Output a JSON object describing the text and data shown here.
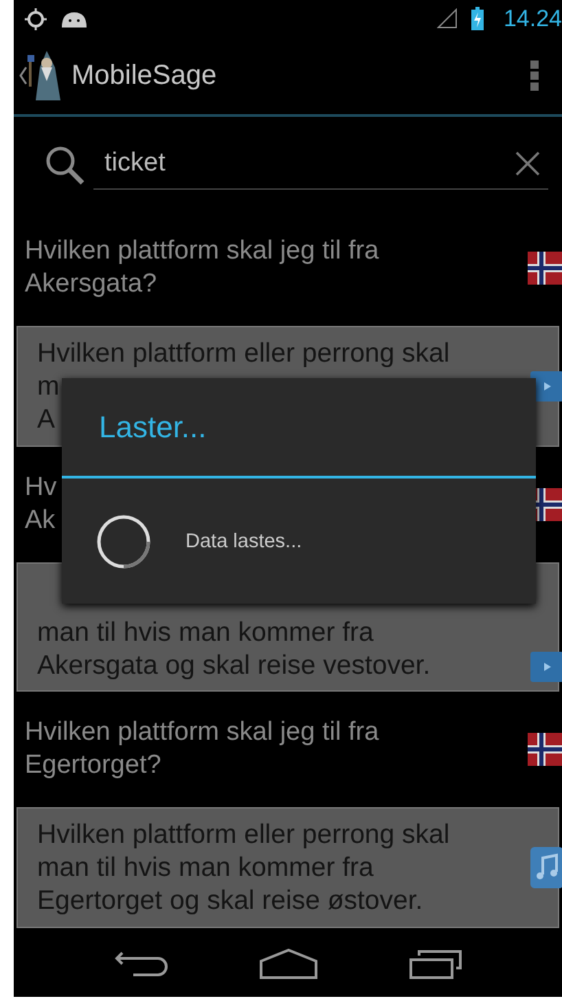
{
  "status_bar": {
    "time": "14.24"
  },
  "action_bar": {
    "title": "MobileSage"
  },
  "search": {
    "value": "ticket"
  },
  "results": [
    {
      "kind": "question",
      "icon": {
        "kind": "flag"
      },
      "lines": [
        "Hvilken plattform skal jeg til fra",
        "Akersgata?"
      ]
    },
    {
      "kind": "answer",
      "icon": {
        "kind": "video"
      },
      "lines": [
        "Hvilken plattform eller perrong skal",
        "m",
        "A"
      ]
    },
    {
      "kind": "question",
      "icon": {
        "kind": "flag"
      },
      "lines": [
        "Hv",
        "Ak"
      ]
    },
    {
      "kind": "answer",
      "icon": {
        "kind": "video"
      },
      "lines": [
        "man til hvis man kommer fra",
        "Akersgata og skal reise vestover."
      ]
    },
    {
      "kind": "question",
      "icon": {
        "kind": "flag"
      },
      "lines": [
        "Hvilken plattform skal jeg til fra",
        "Egertorget?"
      ]
    },
    {
      "kind": "answer",
      "icon": {
        "kind": "audio"
      },
      "lines": [
        "Hvilken plattform eller perrong skal",
        "man til hvis man kommer fra",
        "Egertorget og skal reise østover."
      ]
    }
  ],
  "dialog": {
    "title": "Laster...",
    "message": "Data lastes..."
  }
}
